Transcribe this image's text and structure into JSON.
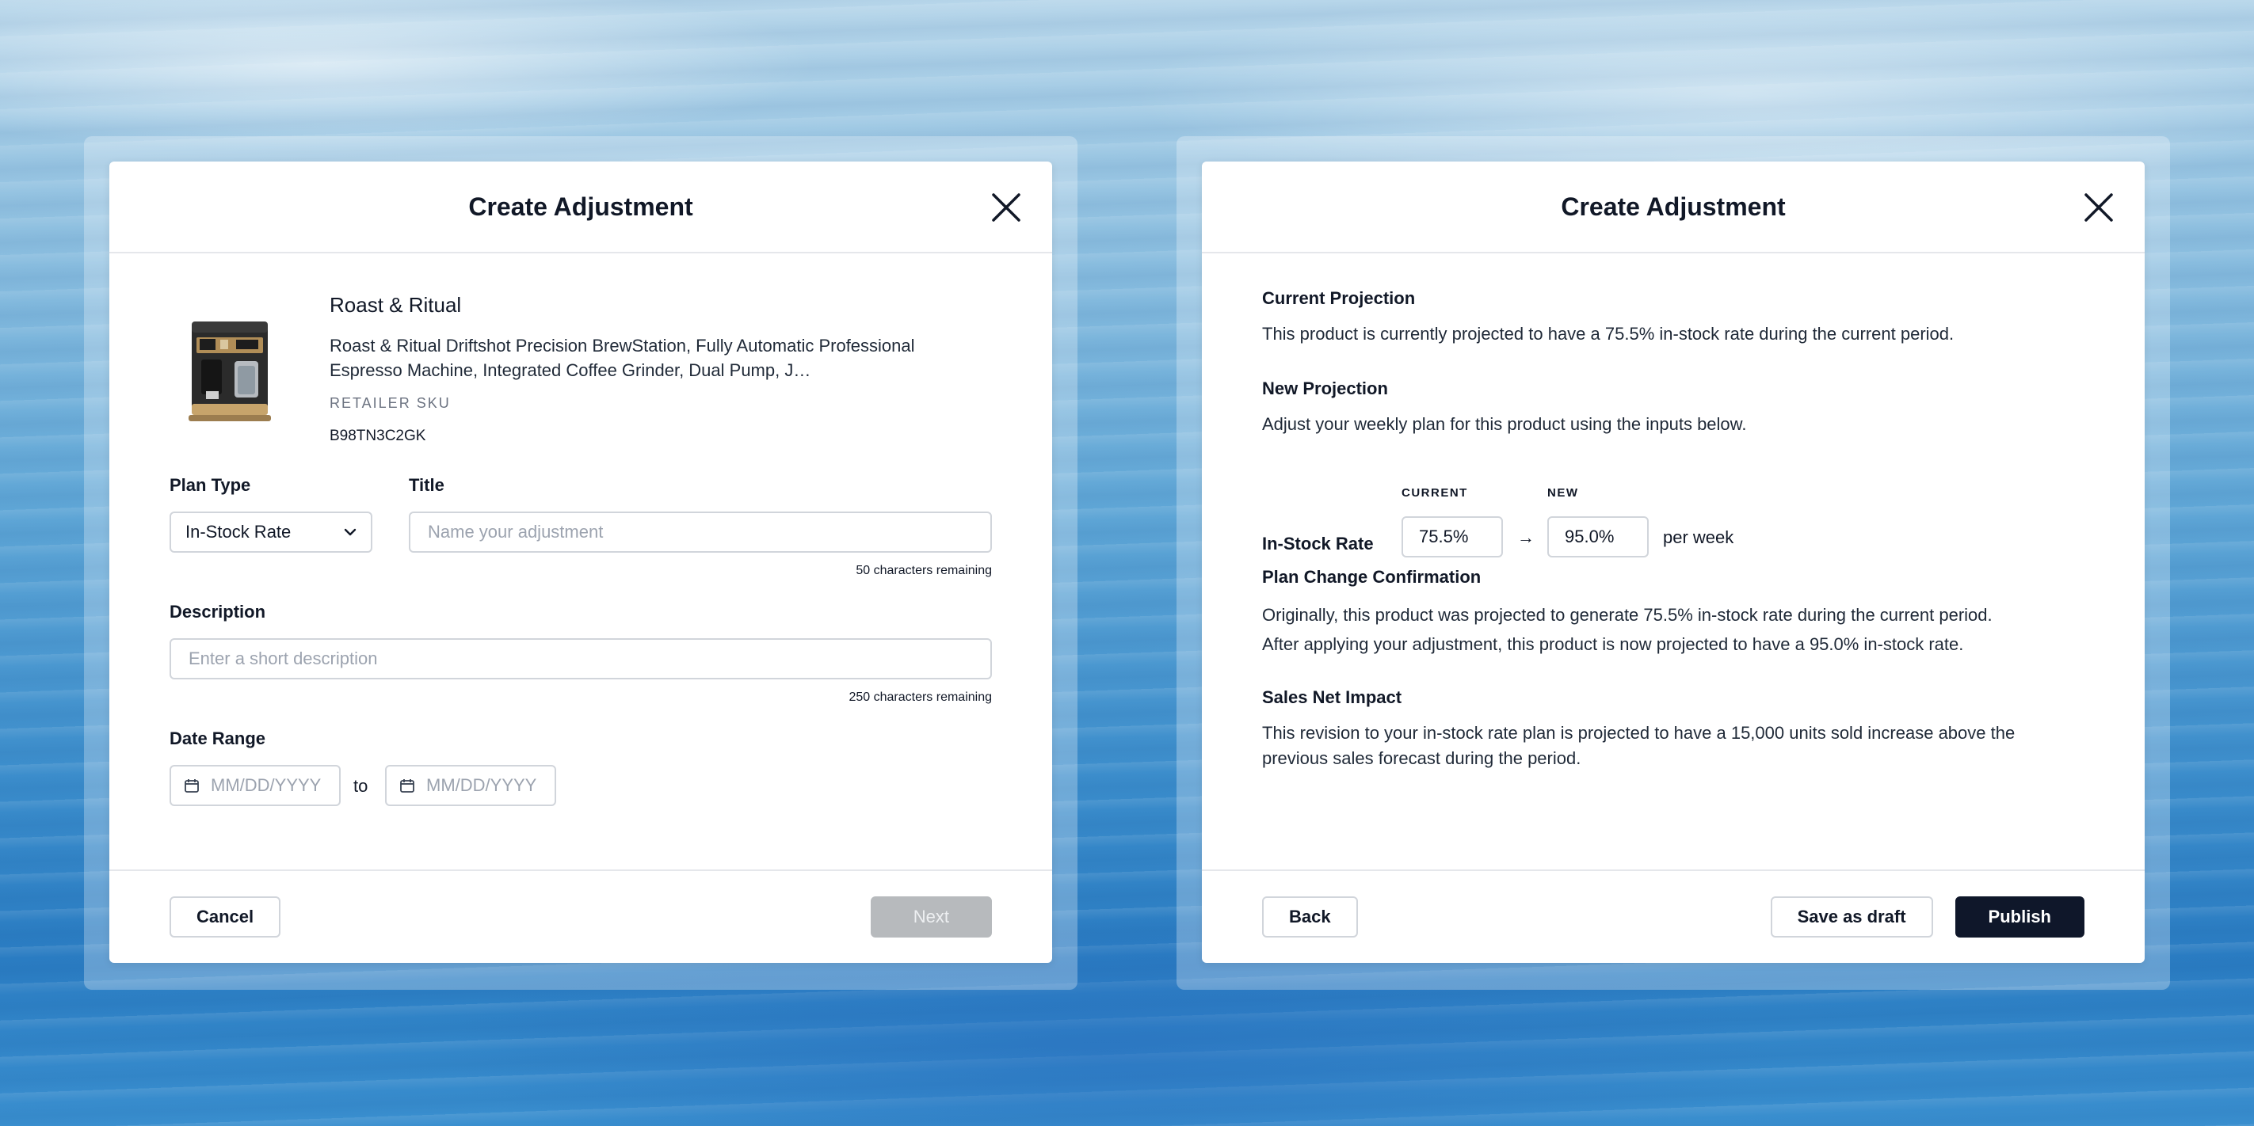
{
  "left_modal": {
    "title": "Create Adjustment",
    "product": {
      "brand": "Roast & Ritual",
      "name": "Roast & Ritual Driftshot Precision BrewStation, Fully Automatic Professional Espresso Machine, Integrated Coffee Grinder, Dual Pump, J…",
      "sku_label": "RETAILER SKU",
      "sku_value": "B98TN3C2GK",
      "image_icon": "espresso-machine"
    },
    "plan_type": {
      "label": "Plan Type",
      "value": "In-Stock Rate"
    },
    "title_field": {
      "label": "Title",
      "placeholder": "Name your adjustment",
      "helper": "50 characters remaining"
    },
    "description": {
      "label": "Description",
      "placeholder": "Enter a short description",
      "helper": "250 characters remaining"
    },
    "date_range": {
      "label": "Date Range",
      "start_placeholder": "MM/DD/YYYY",
      "separator": "to",
      "end_placeholder": "MM/DD/YYYY"
    },
    "footer": {
      "cancel": "Cancel",
      "next": "Next"
    }
  },
  "right_modal": {
    "title": "Create Adjustment",
    "current_projection": {
      "heading": "Current Projection",
      "text": "This product is currently projected to have a 75.5% in-stock rate during the current period."
    },
    "new_projection": {
      "heading": "New Projection",
      "text": "Adjust your weekly plan for this product using the inputs below."
    },
    "rate": {
      "label": "In-Stock Rate",
      "current_label": "CURRENT",
      "new_label": "NEW",
      "current_value": "75.5%",
      "arrow": "→",
      "new_value": "95.0%",
      "unit": "per week"
    },
    "confirmation": {
      "heading": "Plan Change Confirmation",
      "line1": "Originally, this product was projected to generate 75.5% in-stock rate during the current period.",
      "line2": "After applying your adjustment, this product is now projected to have a 95.0% in-stock rate."
    },
    "impact": {
      "heading": "Sales Net Impact",
      "text": "This revision to your in-stock rate plan is projected to have a 15,000 units sold increase above the previous sales forecast during the period."
    },
    "footer": {
      "back": "Back",
      "save_draft": "Save as draft",
      "publish": "Publish"
    }
  },
  "colors": {
    "primary_button": "#0f172a",
    "disabled_button": "#b7babd",
    "border": "#d1d5db",
    "placeholder": "#9ca3af"
  }
}
